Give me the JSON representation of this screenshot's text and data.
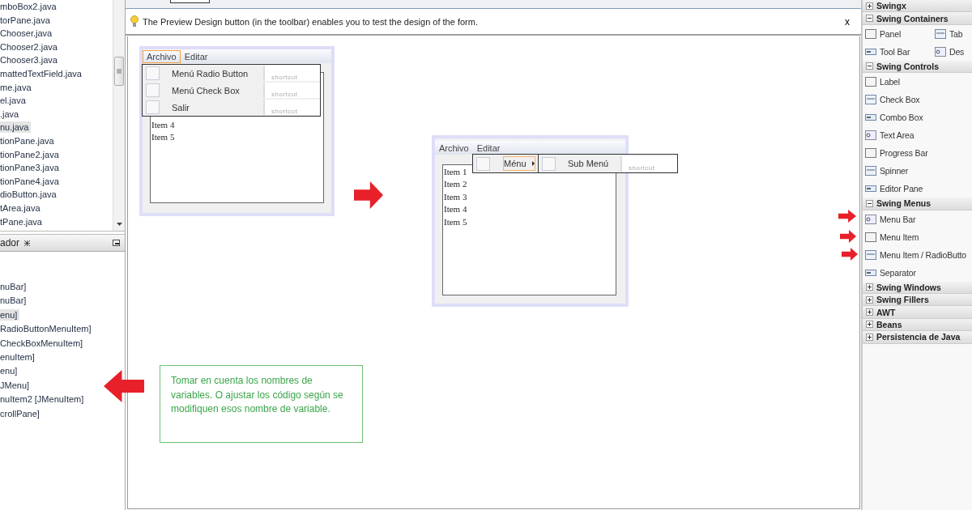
{
  "files": [
    {
      "label": "mboBox2.java",
      "selected": false
    },
    {
      "label": "torPane.java",
      "selected": false
    },
    {
      "label": "Chooser.java",
      "selected": false
    },
    {
      "label": "Chooser2.java",
      "selected": false
    },
    {
      "label": "Chooser3.java",
      "selected": false
    },
    {
      "label": "mattedTextField.java",
      "selected": false
    },
    {
      "label": "me.java",
      "selected": false
    },
    {
      "label": "el.java",
      "selected": false
    },
    {
      "label": ".java",
      "selected": false
    },
    {
      "label": "nu.java",
      "selected": true
    },
    {
      "label": "tionPane.java",
      "selected": false
    },
    {
      "label": "tionPane2.java",
      "selected": false
    },
    {
      "label": "tionPane3.java",
      "selected": false
    },
    {
      "label": "tionPane4.java",
      "selected": false
    },
    {
      "label": "dioButton.java",
      "selected": false
    },
    {
      "label": "tArea.java",
      "selected": false
    },
    {
      "label": "tPane.java",
      "selected": false
    }
  ],
  "navigator": {
    "title": "ador",
    "items": [
      {
        "label": "nuBar]",
        "selected": false
      },
      {
        "label": "nuBar]",
        "selected": false
      },
      {
        "label": "enu]",
        "selected": true
      },
      {
        "label": "RadioButtonMenuItem]",
        "selected": false
      },
      {
        "label": "CheckBoxMenuItem]",
        "selected": false
      },
      {
        "label": "enuItem]",
        "selected": false
      },
      {
        "label": "enu]",
        "selected": false
      },
      {
        "label": "JMenu]",
        "selected": false
      },
      {
        "label": "nuItem2 [JMenuItem]",
        "selected": false
      },
      {
        "label": "crollPane]",
        "selected": false
      }
    ]
  },
  "info_bar": {
    "text": "The Preview Design button (in the toolbar) enables you to test the design of the form.",
    "close": "x"
  },
  "forms": [
    {
      "menus": [
        {
          "label": "Archivo",
          "selected": true
        },
        {
          "label": "Editar",
          "selected": false
        }
      ],
      "menu_items": [
        {
          "label": "Menú Radio Button",
          "shortcut": "shortcut",
          "selected": false,
          "checked": false
        },
        {
          "label": "Menú Check Box",
          "shortcut": "shortcut",
          "selected": false,
          "checked": false
        },
        {
          "label": "Salir",
          "shortcut": "shortcut",
          "selected": false,
          "checked": false
        }
      ],
      "list_items": [
        "Item 4",
        "Item 5"
      ]
    },
    {
      "menus": [
        {
          "label": "Archivo",
          "selected": false
        },
        {
          "label": "Editar",
          "selected": false
        }
      ],
      "menu_items": [
        {
          "label": "Ménu",
          "selected": true,
          "checked": false,
          "submenu": [
            {
              "label": "Sub Menú",
              "shortcut": "shortcut",
              "checked": false
            }
          ]
        }
      ],
      "list_items": [
        "Item 1",
        "Item 2",
        "Item 3",
        "Item 4",
        "Item 5"
      ]
    }
  ],
  "note": "Tomar en cuenta los nombres de variables. O ajustar los código según se modifiquen esos nombre de variable.",
  "palette": [
    {
      "label": "Swingx",
      "expanded": false
    },
    {
      "label": "Swing Containers",
      "expanded": true,
      "kind": "grid",
      "items": [
        "Panel",
        "Tab",
        "Tool Bar",
        "Des"
      ]
    },
    {
      "label": "Swing Controls",
      "expanded": true,
      "kind": "list",
      "items": [
        "Label",
        "Check Box",
        "Combo Box",
        "Text Area",
        "Progress Bar",
        "Spinner",
        "Editor Pane"
      ]
    },
    {
      "label": "Swing Menus",
      "expanded": true,
      "kind": "list",
      "items": [
        "Menu Bar",
        "Menu Item",
        "Menu Item / RadioButto",
        "Separator"
      ]
    },
    {
      "label": "Swing Windows",
      "expanded": false
    },
    {
      "label": "Swing Fillers",
      "expanded": false
    },
    {
      "label": "AWT",
      "expanded": false
    },
    {
      "label": "Beans",
      "expanded": false
    },
    {
      "label": "Persistencia de Java",
      "expanded": false
    }
  ]
}
